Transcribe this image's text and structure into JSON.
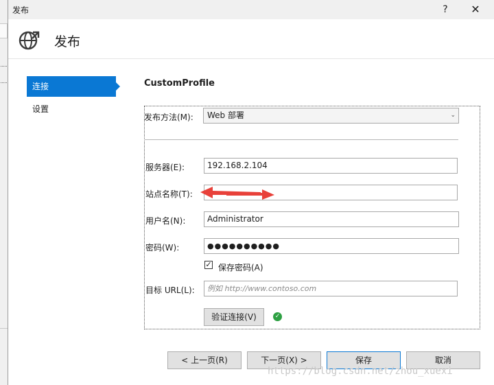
{
  "window": {
    "title": "发布",
    "help_glyph": "?",
    "close_glyph": "✕"
  },
  "header": {
    "title": "发布",
    "icon": "globe-publish-icon"
  },
  "nav": {
    "items": [
      {
        "label": "连接",
        "active": true
      },
      {
        "label": "设置",
        "active": false
      }
    ]
  },
  "profile": {
    "name": "CustomProfile"
  },
  "form": {
    "method_label": "发布方法(M):",
    "method_value": "Web 部署",
    "server_label": "服务器(E):",
    "server_value": "192.168.2.104",
    "site_label": "站点名称(T):",
    "site_value": "",
    "user_label": "用户名(N):",
    "user_value": "Administrator",
    "password_label": "密码(W):",
    "password_value": "●●●●●●●●●●",
    "save_password_label": "保存密码(A)",
    "save_password_checked": true,
    "dest_url_label": "目标 URL(L):",
    "dest_url_placeholder": "例如 http://www.contoso.com",
    "validate_label": "验证连接(V)"
  },
  "buttons": {
    "prev": "< 上一页(R)",
    "next": "下一页(X) >",
    "save": "保存",
    "cancel": "取消"
  },
  "watermark": "https://blog.csdn.net/zhou_xuexi",
  "colors": {
    "accent": "#0a78d4",
    "annotation": "#e8413a",
    "success": "#2ea043"
  }
}
